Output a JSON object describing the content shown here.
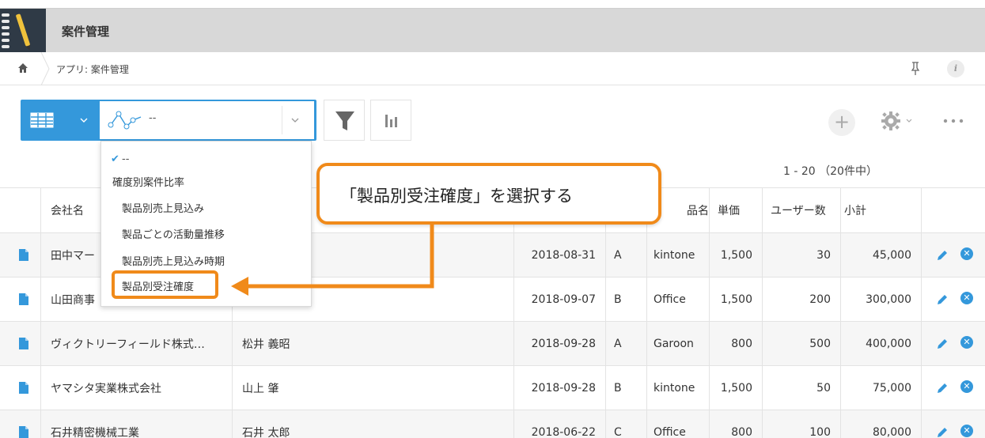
{
  "header": {
    "app_title": "案件管理",
    "app_icon": "notebook-pen-icon"
  },
  "breadcrumb": {
    "text": "アプリ: 案件管理"
  },
  "toolbar": {
    "graph_value": "--",
    "info_label": "i",
    "add_label": "+",
    "pager": "1 - 20 （20件中）"
  },
  "dropdown": {
    "items": [
      {
        "label": "--",
        "checked": true
      },
      {
        "label": "確度別案件比率"
      },
      {
        "label": "製品別売上見込み"
      },
      {
        "label": "製品ごとの活動量推移"
      },
      {
        "label": "製品別売上見込み時期"
      },
      {
        "label": "製品別受注確度"
      }
    ],
    "check_mark": "✔"
  },
  "callout": {
    "text": "「製品別受注確度」を選択する",
    "color": "#f08a1a"
  },
  "table": {
    "headers": {
      "company": "会社名",
      "product": "品名",
      "unit_price": "単価",
      "users": "ユーザー数",
      "subtotal": "小計"
    },
    "rows": [
      {
        "company": "田中マー",
        "person": "",
        "date": "2018-08-31",
        "grade": "A",
        "product": "kintone",
        "unit_price": "1,500",
        "users": "30",
        "subtotal": "45,000"
      },
      {
        "company": "山田商事",
        "person": "",
        "date": "2018-09-07",
        "grade": "B",
        "product": "Office",
        "unit_price": "1,500",
        "users": "200",
        "subtotal": "300,000"
      },
      {
        "company": "ヴィクトリーフィールド株式…",
        "person": "松井 義昭",
        "date": "2018-09-28",
        "grade": "A",
        "product": "Garoon",
        "unit_price": "800",
        "users": "500",
        "subtotal": "400,000"
      },
      {
        "company": "ヤマシタ実業株式会社",
        "person": "山上 肇",
        "date": "2018-09-28",
        "grade": "B",
        "product": "kintone",
        "unit_price": "1,500",
        "users": "50",
        "subtotal": "75,000"
      },
      {
        "company": "石井精密機械工業",
        "person": "石井 太郎",
        "date": "2018-06-22",
        "grade": "C",
        "product": "Office",
        "unit_price": "800",
        "users": "100",
        "subtotal": "80,000"
      }
    ],
    "delete_glyph": "✕"
  },
  "colors": {
    "accent": "#3498db",
    "highlight": "#f08a1a",
    "header_bg": "#d8d8d8"
  }
}
